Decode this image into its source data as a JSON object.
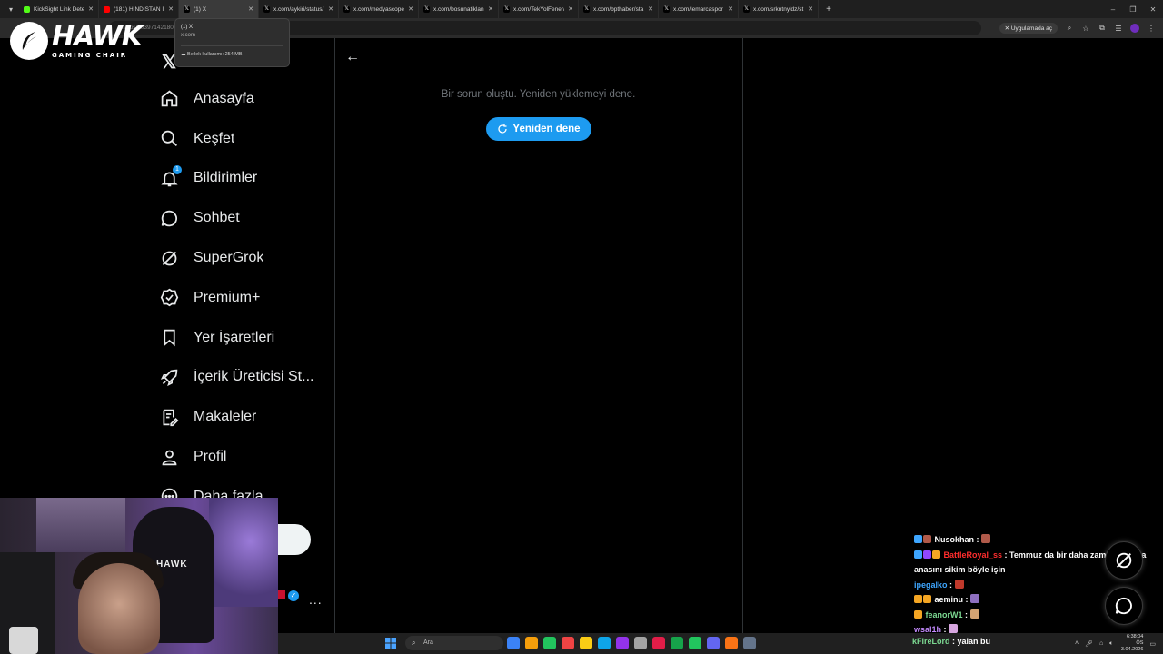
{
  "browser": {
    "tabs": [
      {
        "title": "KickSight Link Detector",
        "fav_color": "#53fc18",
        "active": false
      },
      {
        "title": "(181) HİNDİSTAN İl...",
        "fav_color": "#ff0000",
        "active": false
      },
      {
        "title": "(1) X",
        "fav_color": "#000000",
        "active": true
      },
      {
        "title": "x.com/aykiri/status/",
        "fav_color": "#000000",
        "active": false
      },
      {
        "title": "x.com/medyascope/",
        "fav_color": "#000000",
        "active": false
      },
      {
        "title": "x.com/bosunatiklan",
        "fav_color": "#000000",
        "active": false
      },
      {
        "title": "x.com/TekYolFener/",
        "fav_color": "#000000",
        "active": false
      },
      {
        "title": "x.com/bpthaber/sta",
        "fav_color": "#000000",
        "active": false
      },
      {
        "title": "x.com/lemarcaspor",
        "fav_color": "#000000",
        "active": false
      },
      {
        "title": "x.com/srkntnyldz/st",
        "fav_color": "#000000",
        "active": false
      }
    ],
    "address": "status/203971421804",
    "open_in_app": "Uygulamada aç",
    "hover_card": {
      "title": "(1) X",
      "domain": "x.com",
      "memory": "Bellek kullanımı: 254 MB"
    }
  },
  "overlay": {
    "brand": "HAWK",
    "brand_sub": "GAMING CHAIR",
    "chair_label": "HAWK"
  },
  "sidebar": {
    "items": [
      {
        "label": "Anasayfa",
        "icon": "home-icon"
      },
      {
        "label": "Keşfet",
        "icon": "search-icon"
      },
      {
        "label": "Bildirimler",
        "icon": "bell-icon",
        "badge": "1"
      },
      {
        "label": "Sohbet",
        "icon": "chat-icon"
      },
      {
        "label": "SuperGrok",
        "icon": "grok-icon"
      },
      {
        "label": "Premium+",
        "icon": "verified-badge-icon"
      },
      {
        "label": "Yer İşaretleri",
        "icon": "bookmark-icon"
      },
      {
        "label": "İçerik Üreticisi St...",
        "icon": "rocket-icon"
      },
      {
        "label": "Makaleler",
        "icon": "article-icon"
      },
      {
        "label": "Profil",
        "icon": "person-icon"
      },
      {
        "label": "Daha fazla",
        "icon": "more-icon"
      }
    ],
    "more_dots": "..."
  },
  "main": {
    "error_message": "Bir sorun oluştu. Yeniden yüklemeyi dene.",
    "retry_label": "Yeniden dene"
  },
  "chat": {
    "messages": [
      {
        "user": "Nusokhan",
        "color": "#ffffff",
        "message": ""
      },
      {
        "user": "BattleRoyal_ss",
        "color": "#ff2d2d",
        "message": "Temmuz da bir daha zam gelirse ya anasını sikim böyle işin"
      },
      {
        "user": "ipegalko",
        "color": "#3ea6ff",
        "message": ""
      },
      {
        "user": "aeminu",
        "color": "#ffffff",
        "message": ""
      },
      {
        "user": "feanorW1",
        "color": "#7cd992",
        "message": ""
      },
      {
        "user": "wsal1h",
        "color": "#c58bff",
        "message": ""
      }
    ],
    "last_user": "kFireLord",
    "last_message": "yalan bu"
  },
  "taskbar": {
    "search_placeholder": "Ara",
    "time": "6:38:04 ÖS",
    "date": "3.04.2026",
    "apps": [
      "#3b82f6",
      "#f59e0b",
      "#22c55e",
      "#ef4444",
      "#facc15",
      "#0ea5e9",
      "#9333ea",
      "#a3a3a3",
      "#e11d48",
      "#16a34a",
      "#22c55e",
      "#6366f1",
      "#f97316",
      "#64748b"
    ]
  }
}
